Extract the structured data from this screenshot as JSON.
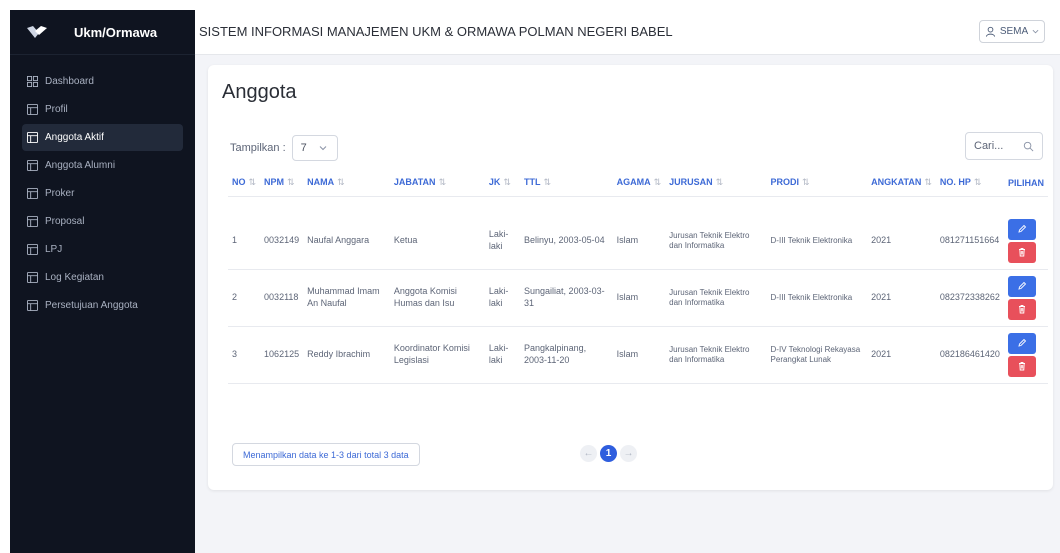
{
  "brand": {
    "title": "Ukm/Ormawa"
  },
  "header": {
    "title": "SISTEM INFORMASI MANAJEMEN UKM & ORMAWA POLMAN NEGERI BABEL",
    "user": "SEMA"
  },
  "sidebar": {
    "items": [
      {
        "label": "Dashboard",
        "icon": "dashboard-icon"
      },
      {
        "label": "Profil",
        "icon": "table-icon"
      },
      {
        "label": "Anggota Aktif",
        "icon": "table-icon",
        "active": true
      },
      {
        "label": "Anggota Alumni",
        "icon": "table-icon"
      },
      {
        "label": "Proker",
        "icon": "table-icon"
      },
      {
        "label": "Proposal",
        "icon": "table-icon"
      },
      {
        "label": "LPJ",
        "icon": "table-icon"
      },
      {
        "label": "Log Kegiatan",
        "icon": "table-icon"
      },
      {
        "label": "Persetujuan Anggota",
        "icon": "table-icon"
      }
    ]
  },
  "main": {
    "title": "Anggota",
    "length": {
      "label": "Tampilkan :",
      "value": "7"
    },
    "search": {
      "placeholder": "Cari..."
    },
    "columns": [
      "NO",
      "NPM",
      "NAMA",
      "JABATAN",
      "JK",
      "TTL",
      "AGAMA",
      "JURUSAN",
      "PRODI",
      "ANGKATAN",
      "NO. HP",
      "PILIHAN"
    ],
    "rows": [
      [
        "1",
        "0032149",
        "Naufal Anggara",
        "Ketua",
        "Laki-laki",
        "Belinyu, 2003-05-04",
        "Islam",
        "Jurusan Teknik Elektro dan Informatika",
        "D-III Teknik Elektronika",
        "2021",
        "081271151664"
      ],
      [
        "2",
        "0032118",
        "Muhammad Imam An Naufal",
        "Anggota Komisi Humas dan Isu",
        "Laki-laki",
        "Sungailiat, 2003-03-31",
        "Islam",
        "Jurusan Teknik Elektro dan Informatika",
        "D-III Teknik Elektronika",
        "2021",
        "082372338262"
      ],
      [
        "3",
        "1062125",
        "Reddy Ibrachim",
        "Koordinator Komisi Legislasi",
        "Laki-laki",
        "Pangkalpinang, 2003-11-20",
        "Islam",
        "Jurusan Teknik Elektro dan Informatika",
        "D-IV Teknologi Rekayasa Perangkat Lunak",
        "2021",
        "082186461420"
      ]
    ],
    "info": "Menampilkan data ke 1-3 dari total 3 data",
    "pagination": {
      "prev": "←",
      "current": "1",
      "next": "→"
    }
  },
  "colors": {
    "sidebar_bg": "#0f1420",
    "accent": "#3b6fe6",
    "danger": "#e8505b"
  }
}
